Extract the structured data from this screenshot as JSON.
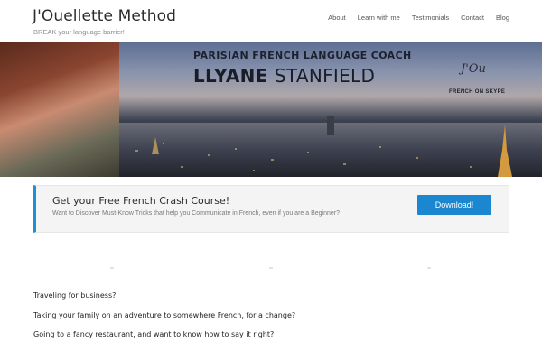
{
  "header": {
    "site_title": "J'Ouellette Method",
    "tagline": "BREAK your language barrier!",
    "nav": [
      "About",
      "Learn with me",
      "Testimonials",
      "Contact",
      "Blog"
    ]
  },
  "banner": {
    "coach_line": "PARISIAN FRENCH LANGUAGE COACH",
    "name_first": "LLYANE",
    "name_last": "STANFIELD",
    "logo_text": "J'Ou",
    "skype_text": "FRENCH ON SKYPE"
  },
  "cta": {
    "title": "Get your Free French Crash Course!",
    "subtitle": "Want to Discover Must-Know Tricks that help you Communicate in French, even if you are a Beginner?",
    "button_label": "Download!"
  },
  "content": {
    "paragraphs": [
      "Traveling for business?",
      "Taking your family on an adventure to somewhere French, for a change?",
      "Going to a fancy restaurant, and want to know how to say it right?"
    ]
  },
  "colors": {
    "accent": "#1a87d0",
    "cta_border": "#1e90d6",
    "cta_bg": "#f4f4f4"
  }
}
